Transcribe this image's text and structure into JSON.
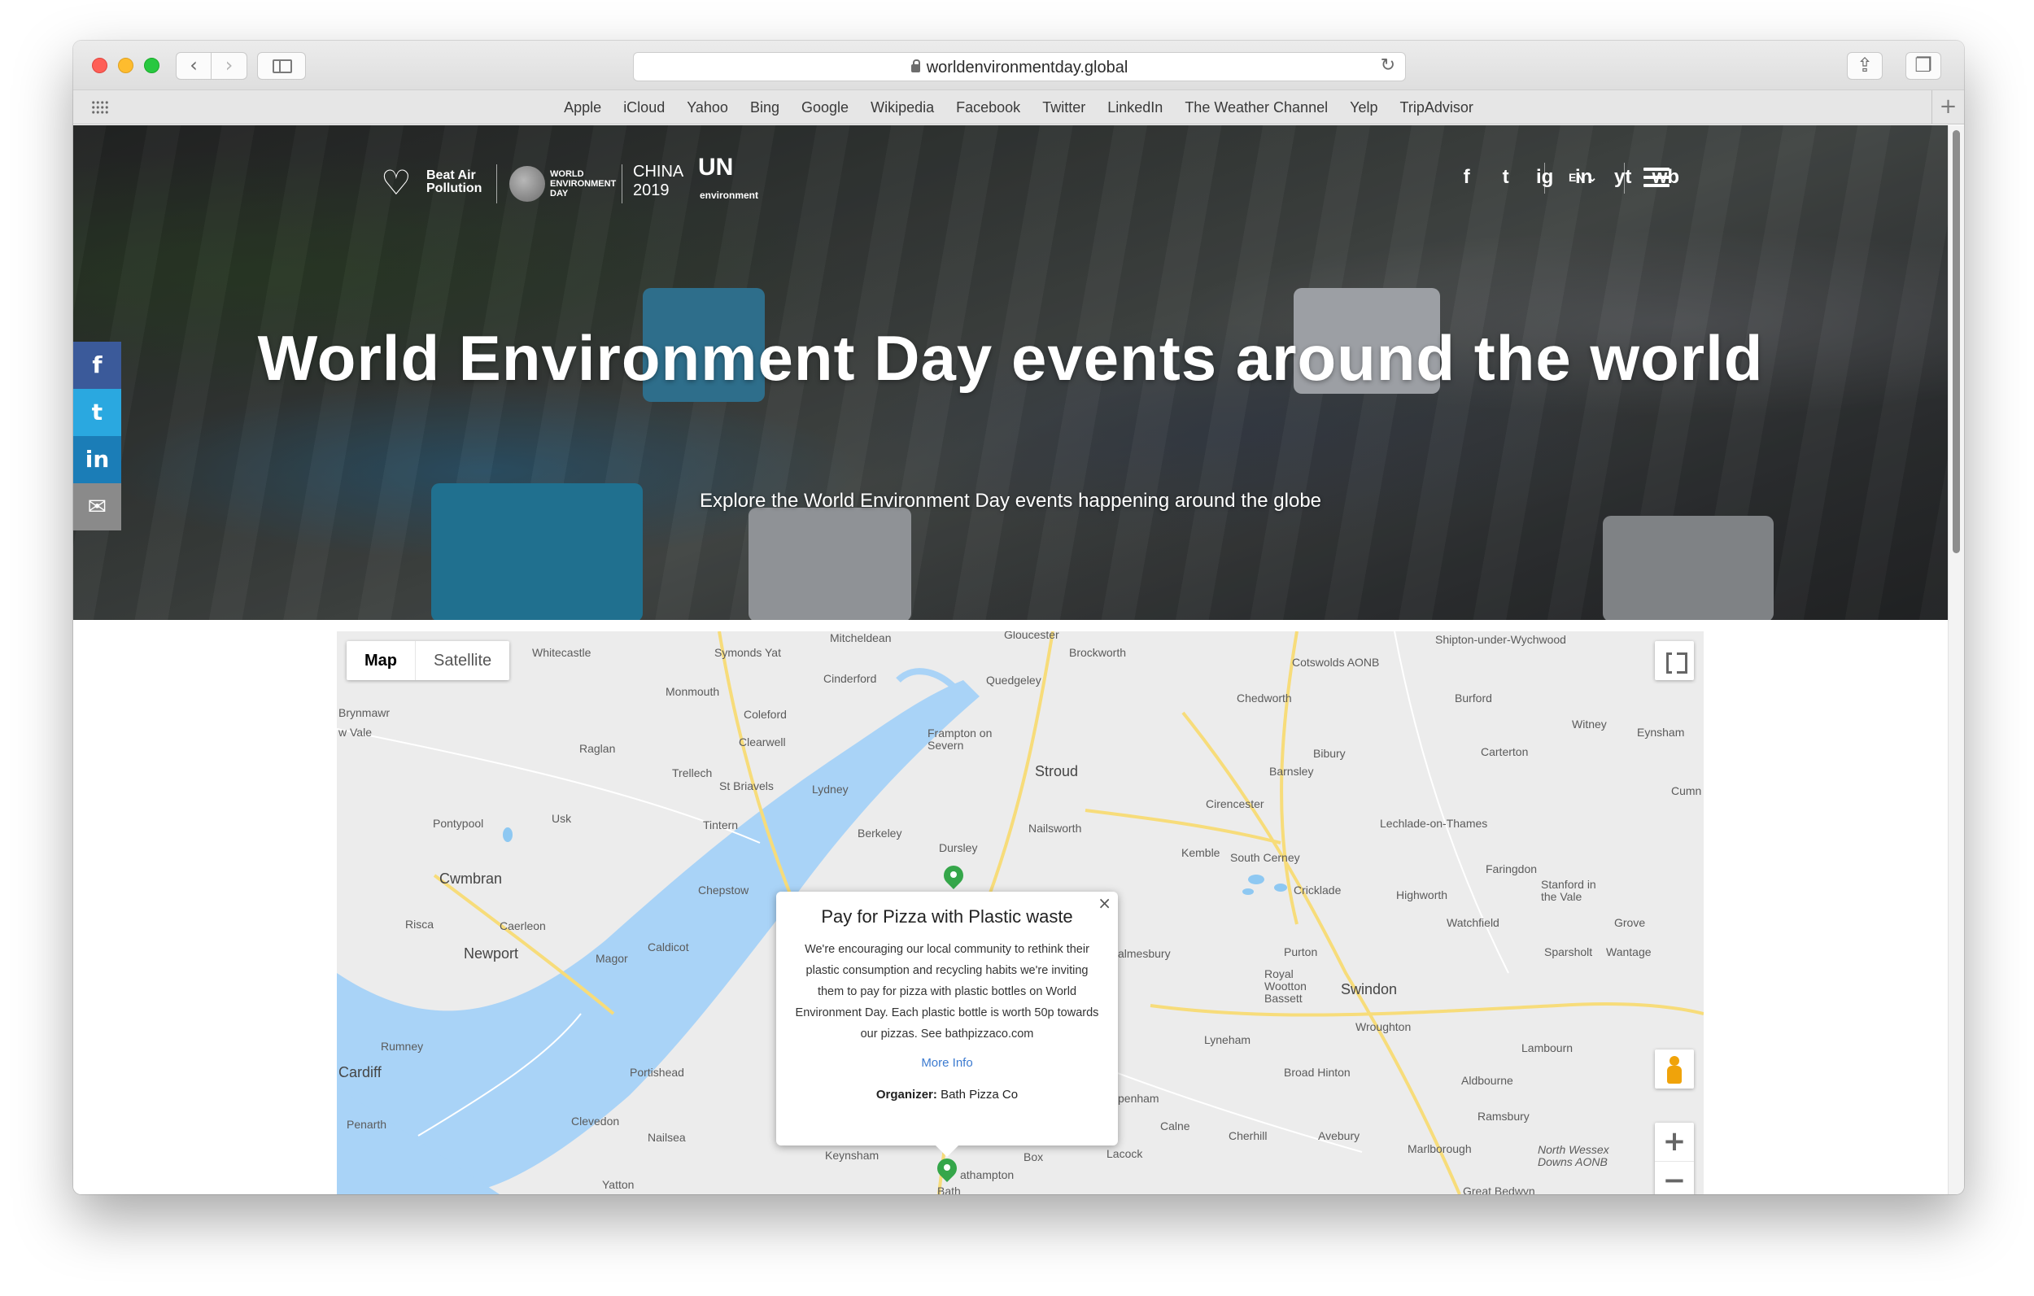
{
  "browser": {
    "url": "worldenvironmentday.global",
    "bookmarks": [
      "Apple",
      "iCloud",
      "Yahoo",
      "Bing",
      "Google",
      "Wikipedia",
      "Facebook",
      "Twitter",
      "LinkedIn",
      "The Weather Channel",
      "Yelp",
      "TripAdvisor"
    ]
  },
  "header": {
    "logo_beat": "Beat Air Pollution",
    "logo_wed": "WORLD ENVIRONMENT DAY",
    "logo_china": "CHINA 2019",
    "logo_un": "UN",
    "logo_un_sub": "environment",
    "social": [
      "f",
      "t",
      "ig",
      "in",
      "yt",
      "wb"
    ],
    "language": "EN"
  },
  "hero": {
    "title": "World Environment Day events around the world",
    "subtitle": "Explore the World Environment Day events happening around the globe"
  },
  "share_sidebar": [
    "f",
    "t",
    "in",
    "✉"
  ],
  "map": {
    "type_map": "Map",
    "type_satellite": "Satellite",
    "zoom_in": "+",
    "zoom_out": "−",
    "labels": [
      "Gloucester",
      "Mitcheldean",
      "Symonds Yat",
      "Whitecastle",
      "Brockworth",
      "Shipton-under-Wychwood",
      "Cotswolds AONB",
      "Cinderford",
      "Quedgeley",
      "Monmouth",
      "Coleford",
      "Chedworth",
      "Burford",
      "Brynmawr",
      "w Vale",
      "Raglan",
      "Clearwell",
      "Frampton on Severn",
      "Witney",
      "Eynsham",
      "Trellech",
      "St Briavels",
      "Lydney",
      "Stroud",
      "Bibury",
      "Carterton",
      "Barnsley",
      "Pontypool",
      "Usk",
      "Tintern",
      "Berkeley",
      "Nailsworth",
      "Cirencester",
      "Lechlade-on-Thames",
      "Cumn",
      "Dursley",
      "Kemble",
      "South Cerney",
      "Faringdon",
      "Stanford in the Vale",
      "Cwmbran",
      "Chepstow",
      "Cricklade",
      "Highworth",
      "Risca",
      "Caerleon",
      "Caldicot",
      "Watchfield",
      "Grove",
      "Newport",
      "Magor",
      "almesbury",
      "Purton",
      "Sparsholt",
      "Wantage",
      "Royal Wootton Bassett",
      "Swindon",
      "Rumney",
      "Wroughton",
      "Lyneham",
      "Lambourn",
      "Cardiff",
      "Portishead",
      "Broad Hinton",
      "Aldbourne",
      "penham",
      "Ramsbury",
      "Penarth",
      "Clevedon",
      "Calne",
      "Cherhill",
      "Avebury",
      "Marlborough",
      "North Wessex Downs AONB",
      "Nailsea",
      "Keynsham",
      "Box",
      "Lacock",
      "Yatton",
      "Bath",
      "athampton",
      "Great Bedwyn"
    ],
    "popup": {
      "title": "Pay for Pizza with Plastic waste",
      "body": "We're encouraging our local community to rethink their plastic consumption and recycling habits we're inviting them to pay for pizza with plastic bottles on World Environment Day. Each plastic bottle is worth 50p towards our pizzas. See bathpizzaco.com",
      "more_info": "More Info",
      "organizer_label": "Organizer:",
      "organizer": "Bath Pizza Co",
      "close": "×"
    }
  }
}
